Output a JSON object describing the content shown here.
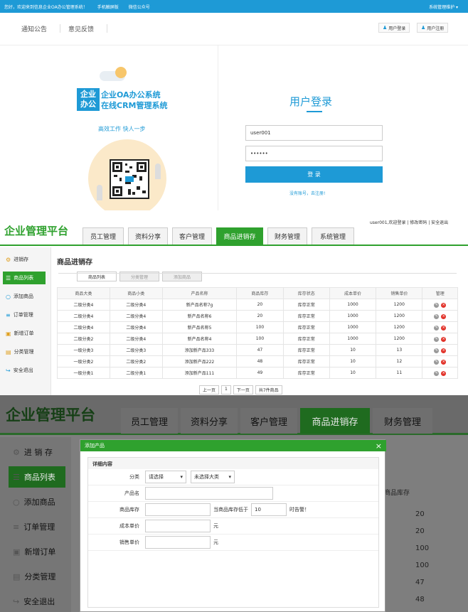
{
  "panel1": {
    "topbar": {
      "welcome": "您好，欢迎来到信息企业OA办公管理系统！",
      "mobile": "手机触屏版",
      "wechat": "微信公众号",
      "maintain": "系统管理维护 ▾"
    },
    "subnav": {
      "notice": "通知公告",
      "feedback": "意见反馈",
      "login_btn": "用户登录",
      "register_btn": "用户注册"
    },
    "logo": {
      "box_line1": "企业",
      "box_line2": "办公",
      "line1": "企业OA办公系统",
      "line2": "在线CRM管理系统"
    },
    "slogan": "高效工作 快人一步",
    "login": {
      "title": "用户登录",
      "username": "user001",
      "password": "••••••",
      "submit": "登 录",
      "register_link": "没有账号，去注册!"
    }
  },
  "panel2": {
    "brand": "企业管理平台",
    "nav": [
      "员工管理",
      "资料分享",
      "客户管理",
      "商品进销存",
      "财务管理",
      "系统管理"
    ],
    "nav_active": 3,
    "userbar": "user001,欢迎登录 | 修改密码 | 安全退出",
    "sidebar": [
      {
        "icon": "gear-icon",
        "label": "进销存"
      },
      {
        "icon": "list-icon",
        "label": "商品列表"
      },
      {
        "icon": "chat-icon",
        "label": "添加商品"
      },
      {
        "icon": "bars-icon",
        "label": "订单管理"
      },
      {
        "icon": "cart-icon",
        "label": "新增订单"
      },
      {
        "icon": "folder-icon",
        "label": "分类管理"
      },
      {
        "icon": "exit-icon",
        "label": "安全退出"
      }
    ],
    "sidebar_active": 1,
    "content_title": "商品进销存",
    "subtabs": [
      "商品列表",
      "分类管理",
      "添加商品"
    ],
    "columns": [
      "商品大类",
      "商品小类",
      "产品名称",
      "商品库存",
      "库存状态",
      "成本单价",
      "销售单价",
      "管理"
    ],
    "rows": [
      [
        "二级分类4",
        "二级分类4",
        "新产品名称7g",
        "20",
        "库存正常",
        "1000",
        "1200"
      ],
      [
        "二级分类4",
        "二级分类4",
        "新产品名称6",
        "20",
        "库存正常",
        "1000",
        "1200"
      ],
      [
        "二级分类4",
        "二级分类4",
        "新产品名称5",
        "100",
        "库存正常",
        "1000",
        "1200"
      ],
      [
        "二级分类2",
        "二级分类4",
        "新产品名称4",
        "100",
        "库存正常",
        "1000",
        "1200"
      ],
      [
        "一级分类3",
        "二级分类3",
        "添加新产品333",
        "47",
        "库存正常",
        "10",
        "13"
      ],
      [
        "一级分类2",
        "二级分类2",
        "添加新产品222",
        "48",
        "库存正常",
        "10",
        "12"
      ],
      [
        "一级分类1",
        "二级分类1",
        "添加新产品111",
        "49",
        "库存正常",
        "10",
        "11"
      ]
    ],
    "pager": {
      "prev": "上一页",
      "current": "1",
      "next": "下一页",
      "total": "共7件商品"
    }
  },
  "panel3": {
    "brand": "企业管理平台",
    "nav": [
      "员工管理",
      "资料分享",
      "客户管理",
      "商品进销存",
      "财务管理"
    ],
    "nav_active": 3,
    "sidebar": [
      {
        "icon": "gear-icon",
        "label": "进 销 存"
      },
      {
        "icon": "list-icon",
        "label": "商品列表"
      },
      {
        "icon": "chat-icon",
        "label": "添加商品"
      },
      {
        "icon": "bars-icon",
        "label": "订单管理"
      },
      {
        "icon": "cart-icon",
        "label": "新增订单"
      },
      {
        "icon": "folder-icon",
        "label": "分类管理"
      },
      {
        "icon": "exit-icon",
        "label": "安全退出"
      }
    ],
    "sidebar_active": 1,
    "bg_column_header": "商品库存",
    "bg_column_values": [
      "20",
      "20",
      "100",
      "100",
      "47",
      "48"
    ],
    "modal": {
      "title": "添加产品",
      "close": "×",
      "section": "详细内容",
      "category_label": "分类",
      "category_select1": "请选择",
      "category_select2": "未选择大类",
      "name_label": "产品名",
      "stock_label": "商品库存",
      "alert_prefix": "当商品库存低于",
      "alert_value": "10",
      "alert_suffix": "时告警！",
      "cost_label": "成本单价",
      "cost_unit": "元",
      "sale_label": "销售单价",
      "sale_unit": "元"
    }
  },
  "colors": {
    "blue": "#1e9ad6",
    "green": "#2fa12e",
    "red": "#e2332a"
  }
}
